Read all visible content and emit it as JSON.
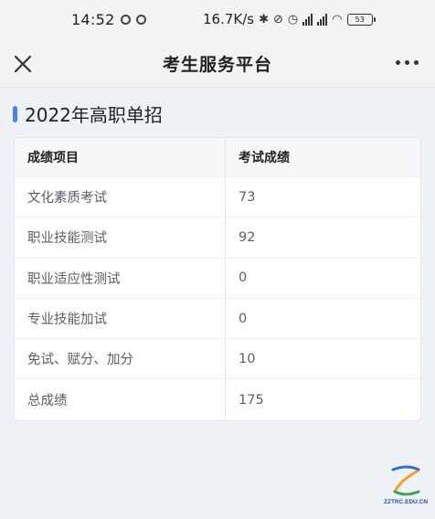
{
  "status_bar": {
    "time": "14:52",
    "net_speed": "16.7K/s",
    "battery": "53"
  },
  "nav": {
    "title": "考生服务平台"
  },
  "section": {
    "title": "2022年高职单招"
  },
  "table": {
    "headers": [
      "成绩项目",
      "考试成绩"
    ],
    "rows": [
      {
        "item": "文化素质考试",
        "score": "73"
      },
      {
        "item": "职业技能测试",
        "score": "92"
      },
      {
        "item": "职业适应性测试",
        "score": "0"
      },
      {
        "item": "专业技能加试",
        "score": "0"
      },
      {
        "item": "免试、赋分、加分",
        "score": "10"
      },
      {
        "item": "总成绩",
        "score": "175"
      }
    ]
  },
  "watermark": {
    "text": "ZZTRC.EDU.CN"
  },
  "colors": {
    "accent": "#4a7ff3",
    "background": "#eef1f6"
  }
}
